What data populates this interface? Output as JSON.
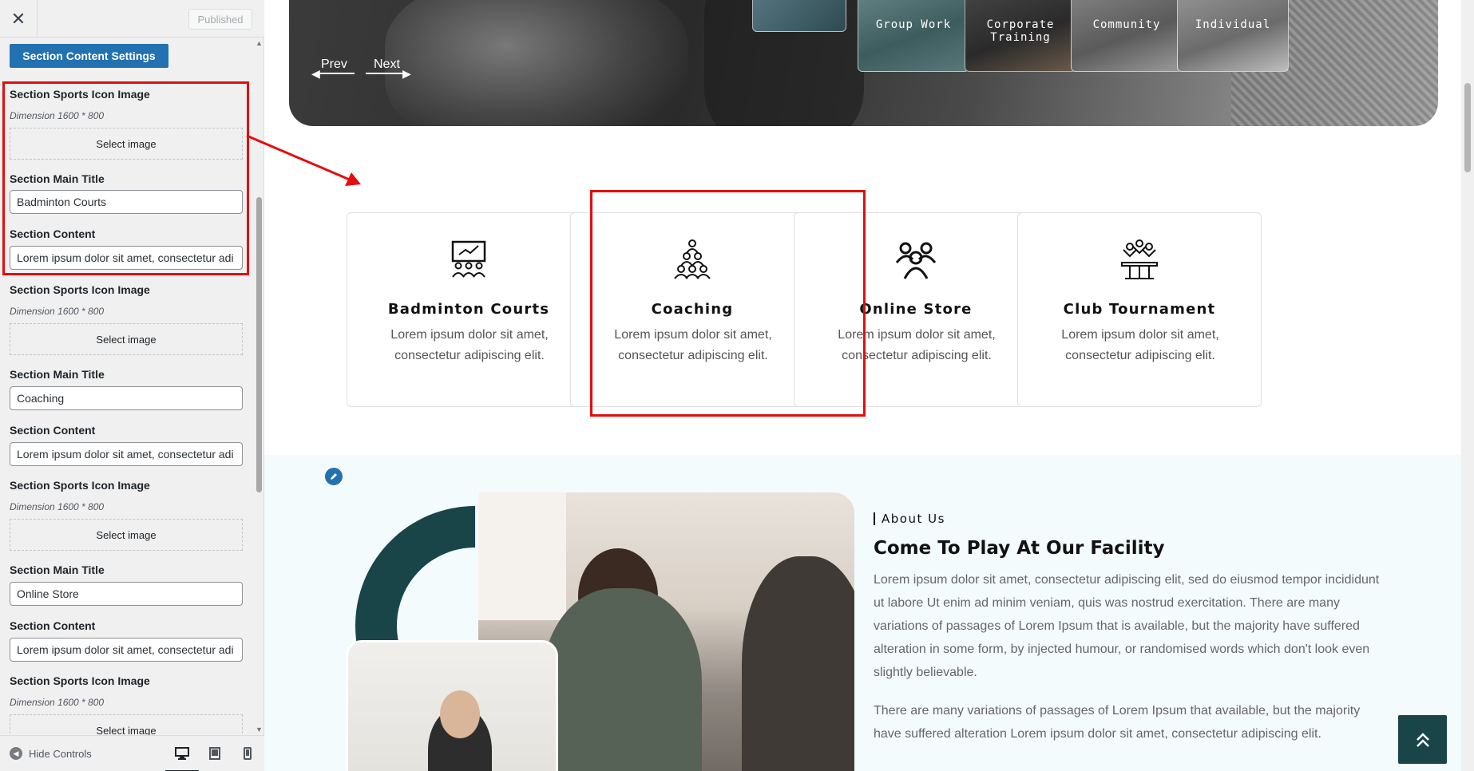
{
  "sidebar": {
    "close_symbol": "✕",
    "published_label": "Published",
    "section_button": "Section Content Settings",
    "fields": [
      {
        "icon_label": "Section Sports Icon Image",
        "dimension": "Dimension 1600 * 800",
        "select_label": "Select image",
        "title_label": "Section Main Title",
        "title_value": "Badminton Courts",
        "content_label": "Section Content",
        "content_value": "Lorem ipsum dolor sit amet, consectetur adi"
      },
      {
        "icon_label": "Section Sports Icon Image",
        "dimension": "Dimension 1600 * 800",
        "select_label": "Select image",
        "title_label": "Section Main Title",
        "title_value": "Coaching",
        "content_label": "Section Content",
        "content_value": "Lorem ipsum dolor sit amet, consectetur adi"
      },
      {
        "icon_label": "Section Sports Icon Image",
        "dimension": "Dimension 1600 * 800",
        "select_label": "Select image",
        "title_label": "Section Main Title",
        "title_value": "Online Store",
        "content_label": "Section Content",
        "content_value": "Lorem ipsum dolor sit amet, consectetur adi"
      },
      {
        "icon_label": "Section Sports Icon Image",
        "dimension": "Dimension 1600 * 800",
        "select_label": "Select image"
      }
    ],
    "hide_controls": "Hide Controls",
    "devices": [
      "desktop-icon",
      "tablet-icon",
      "mobile-icon"
    ]
  },
  "hero": {
    "thumbs": [
      "Group Work",
      "Corporate Training",
      "Community",
      "Individual"
    ],
    "prev": "Prev",
    "next": "Next"
  },
  "cards": [
    {
      "title": "Badminton Courts",
      "desc": "Lorem ipsum dolor sit amet, consectetur adipiscing elit.",
      "icon": "presentation-icon"
    },
    {
      "title": "Coaching",
      "desc": "Lorem ipsum dolor sit amet, consectetur adipiscing elit.",
      "icon": "team-pyramid-icon"
    },
    {
      "title": "Online Store",
      "desc": "Lorem ipsum dolor sit amet, consectetur adipiscing elit.",
      "icon": "group-icon"
    },
    {
      "title": "Club Tournament",
      "desc": "Lorem ipsum dolor sit amet, consectetur adipiscing elit.",
      "icon": "podium-icon"
    }
  ],
  "about": {
    "tag": "About Us",
    "title": "Come To Play At Our Facility",
    "p1": "Lorem ipsum dolor sit amet, consectetur adipiscing elit, sed do eiusmod tempor incididunt ut labore Ut enim ad minim veniam, quis was nostrud exercitation. There are many variations of passages of Lorem Ipsum that is available, but the majority have suffered alteration in some form, by injected humour, or randomised words which don't look even slightly believable.",
    "p2": "There are many variations of passages of Lorem Ipsum that available, but the majority have suffered alteration Lorem ipsum dolor sit amet, consectetur adipiscing elit."
  },
  "colors": {
    "accent_blue": "#2271b1",
    "highlight_red": "#e20e0e",
    "teal_dark": "#194549"
  }
}
